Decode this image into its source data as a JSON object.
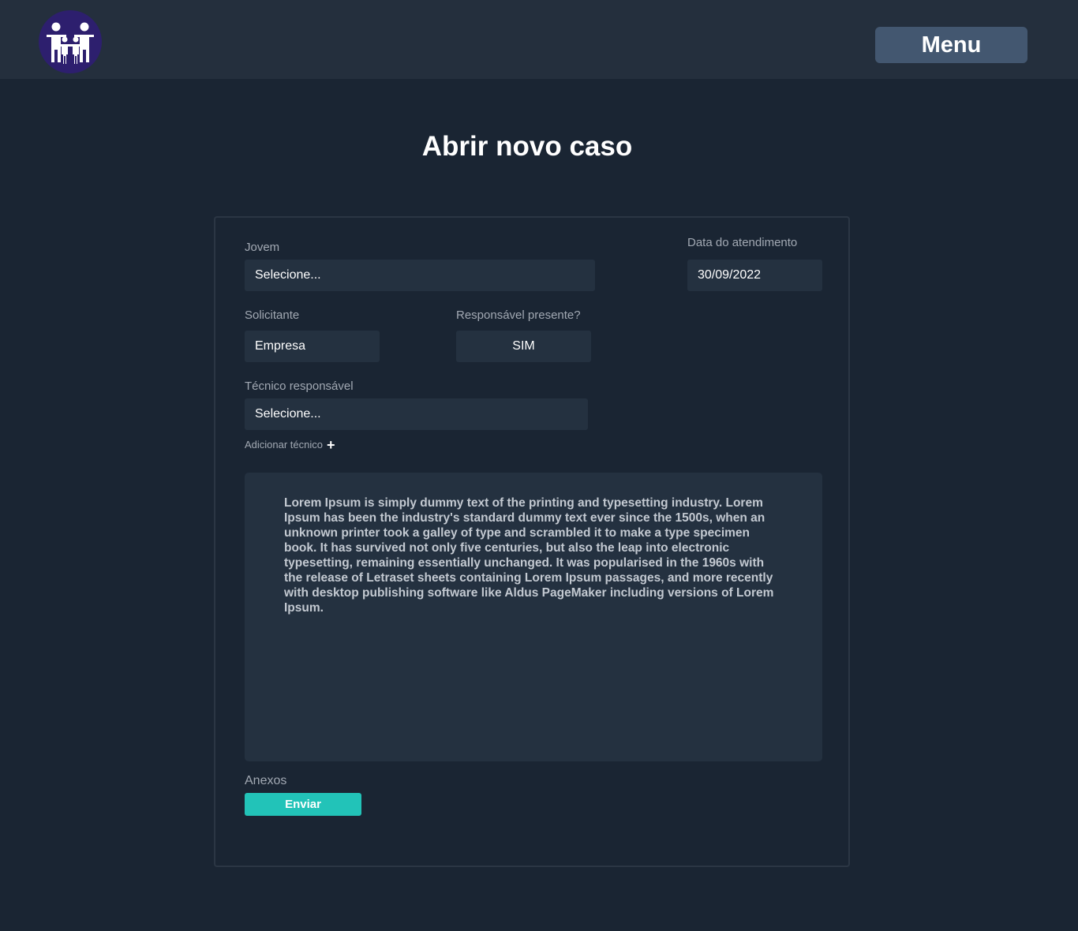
{
  "header": {
    "logo_icon": "family-icon",
    "menu_label": "Menu"
  },
  "page_title": "Abrir novo caso",
  "form": {
    "jovem": {
      "label": "Jovem",
      "value": "Selecione..."
    },
    "data_atendimento": {
      "label": "Data do atendimento",
      "value": "30/09/2022"
    },
    "solicitante": {
      "label": "Solicitante",
      "value": "Empresa"
    },
    "responsavel_presente": {
      "label": "Responsável presente?",
      "value": "SIM"
    },
    "tecnico_responsavel": {
      "label": "Técnico responsável",
      "value": "Selecione..."
    },
    "add_tecnico": {
      "label": "Adicionar técnico",
      "icon": "plus-icon"
    },
    "descricao": "Lorem Ipsum is simply dummy text of the printing and typesetting industry. Lorem Ipsum has been the industry's standard dummy text ever since the 1500s, when an unknown printer took a galley of type and scrambled it to make a type specimen book. It has survived not only five centuries, but also the leap into electronic typesetting, remaining essentially unchanged. It was popularised in the 1960s with the release of Letraset sheets containing Lorem Ipsum passages, and more recently with desktop publishing software like Aldus PageMaker including versions of Lorem Ipsum.",
    "anexos": {
      "label": "Anexos",
      "button_label": "Enviar"
    }
  },
  "colors": {
    "background": "#1a2533",
    "header": "#242f3d",
    "field": "#243140",
    "menu_button": "#435770",
    "accent": "#22c3b8",
    "logo": "#2d1f6e"
  }
}
